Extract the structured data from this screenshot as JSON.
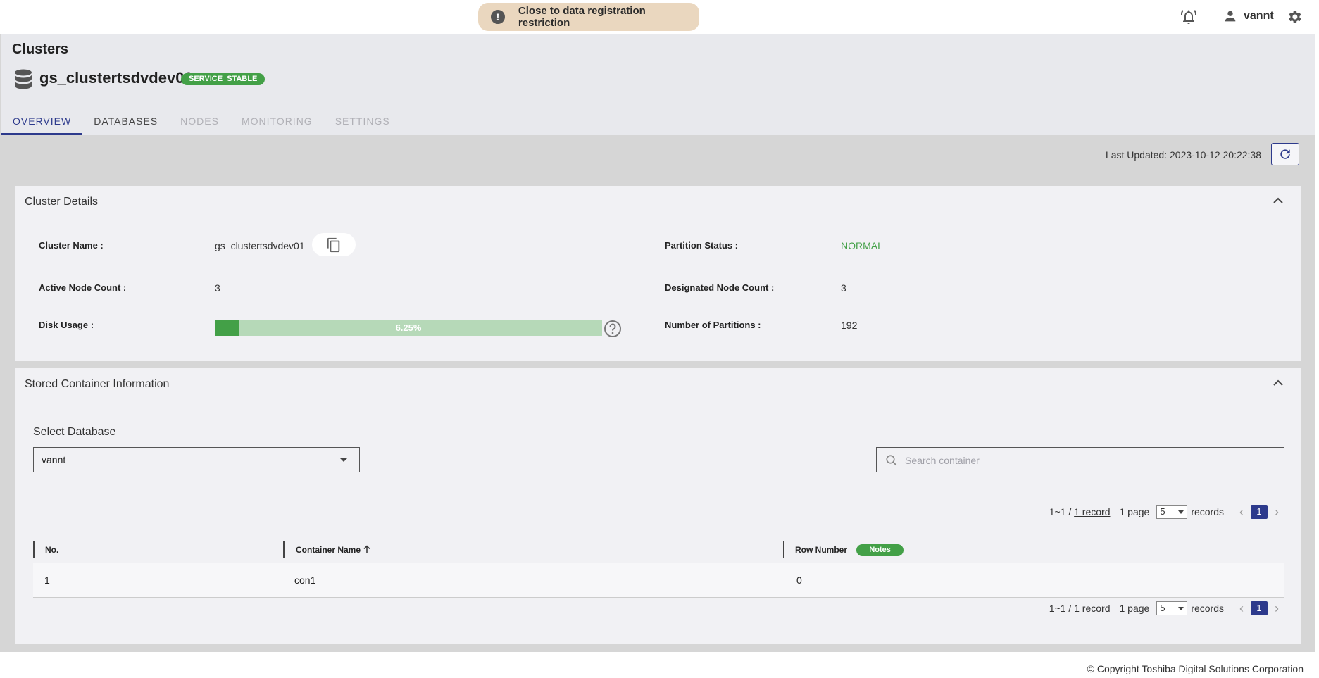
{
  "topbar": {
    "alert_text": "Close to data registration restriction",
    "user_name": "vannt"
  },
  "header": {
    "page_title": "Clusters",
    "cluster_name": "gs_clustertsdvdev01",
    "status_badge": "SERVICE_STABLE",
    "tabs": [
      {
        "label": "OVERVIEW",
        "state": "active"
      },
      {
        "label": "DATABASES",
        "state": "normal"
      },
      {
        "label": "NODES",
        "state": "disabled"
      },
      {
        "label": "MONITORING",
        "state": "disabled"
      },
      {
        "label": "SETTINGS",
        "state": "disabled"
      }
    ]
  },
  "main": {
    "last_updated": "Last Updated: 2023-10-12 20:22:38"
  },
  "cluster_details": {
    "title": "Cluster Details",
    "cluster_name_label": "Cluster Name :",
    "cluster_name_value": "gs_clustertsdvdev01",
    "active_node_label": "Active Node Count :",
    "active_node_value": "3",
    "disk_usage_label": "Disk Usage :",
    "disk_usage_text": "6.25%",
    "disk_usage_fraction": 0.0625,
    "partition_status_label": "Partition Status :",
    "partition_status_value": "NORMAL",
    "designated_node_label": "Designated Node Count :",
    "designated_node_value": "3",
    "partitions_label": "Number of Partitions :",
    "partitions_value": "192"
  },
  "containers": {
    "title": "Stored Container Information",
    "select_label": "Select Database",
    "select_value": "vannt",
    "search_placeholder": "Search container",
    "pager": {
      "range": "1~1 /",
      "records_link": "1 record",
      "pages": "1 page",
      "page_size": "5",
      "records_word": "records",
      "current_page": "1"
    },
    "columns": {
      "no": "No.",
      "container_name": "Container Name",
      "row_number": "Row Number",
      "notes": "Notes"
    },
    "rows": [
      {
        "no": "1",
        "name": "con1",
        "row_number": "0"
      }
    ]
  },
  "footer": {
    "copyright": "© Copyright Toshiba Digital Solutions Corporation"
  },
  "colors": {
    "accent": "#2d3a8c",
    "success": "#43a047",
    "alert_bg": "#ead7bf"
  }
}
